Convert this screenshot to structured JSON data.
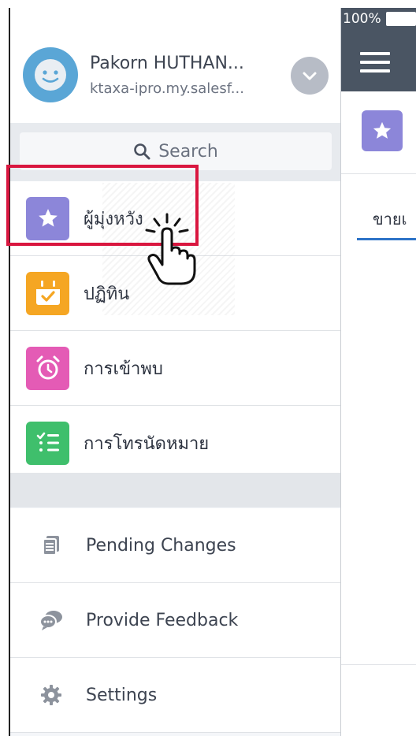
{
  "profile": {
    "name": "Pakorn HUTHAN...",
    "org": "ktaxa-ipro.my.salesf..."
  },
  "search": {
    "placeholder": "Search"
  },
  "nav": {
    "items": [
      {
        "label": "ผู้มุ่งหวัง",
        "icon": "star-icon",
        "color": "#8c86d9"
      },
      {
        "label": "ปฏิทิน",
        "icon": "calendar-icon",
        "color": "#f5a623"
      },
      {
        "label": "การเข้าพบ",
        "icon": "alarm-clock-icon",
        "color": "#e45bb5"
      },
      {
        "label": "การโทรนัดหมาย",
        "icon": "checklist-icon",
        "color": "#3fbf6c"
      }
    ]
  },
  "utility": {
    "items": [
      {
        "label": "Pending Changes",
        "icon": "documents-icon"
      },
      {
        "label": "Provide Feedback",
        "icon": "chat-bubbles-icon"
      },
      {
        "label": "Settings",
        "icon": "gear-icon"
      }
    ]
  },
  "status": {
    "battery": "100%"
  },
  "content": {
    "tab_label": "ขายเ"
  },
  "colors": {
    "highlight": "#d9163f",
    "header": "#4a5563",
    "tab_underline": "#2d73c7"
  }
}
